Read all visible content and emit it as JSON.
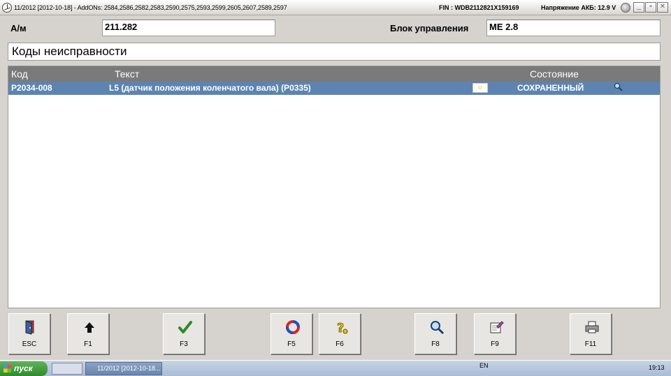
{
  "titlebar": {
    "title": "11/2012 [2012-10-18] - AddONs: 2584,2586,2582,2583,2590,2575,2593,2599,2605,2607,2589,2597",
    "fin": "FIN : WDB2112821X159169",
    "voltage": "Напряжение АКБ: 12.9 V"
  },
  "header": {
    "vehicle_label": "А/м",
    "vehicle_value": "211.282",
    "ecu_label": "Блок управления",
    "ecu_value": "ME 2.8"
  },
  "section": {
    "title": "Коды неисправности"
  },
  "table": {
    "columns": [
      "Код",
      "Текст",
      "Состояние"
    ],
    "rows": [
      {
        "code": "P2034-008",
        "text": "L5 (датчик положения коленчатого вала) (P0335)",
        "state": "СОХРАНЕННЫЙ"
      }
    ]
  },
  "buttons": [
    {
      "key": "ESC",
      "icon": "exit-door-icon"
    },
    {
      "key": "F1",
      "icon": "arrow-up-icon"
    },
    {
      "key": "F3",
      "icon": "checkmark-icon"
    },
    {
      "key": "F5",
      "icon": "refresh-circle-icon"
    },
    {
      "key": "F6",
      "icon": "help-question-icon"
    },
    {
      "key": "F8",
      "icon": "magnifier-icon"
    },
    {
      "key": "F9",
      "icon": "edit-note-icon"
    },
    {
      "key": "F11",
      "icon": "printer-icon"
    }
  ],
  "taskbar": {
    "start_label": "пуск",
    "task_label": "11/2012 [2012-10-18...",
    "lang": "EN",
    "clock": "19:13"
  },
  "colors": {
    "selected_row": "#5d84b0",
    "header_row": "#7a7a7a",
    "window_bg": "#d6d3ce"
  }
}
